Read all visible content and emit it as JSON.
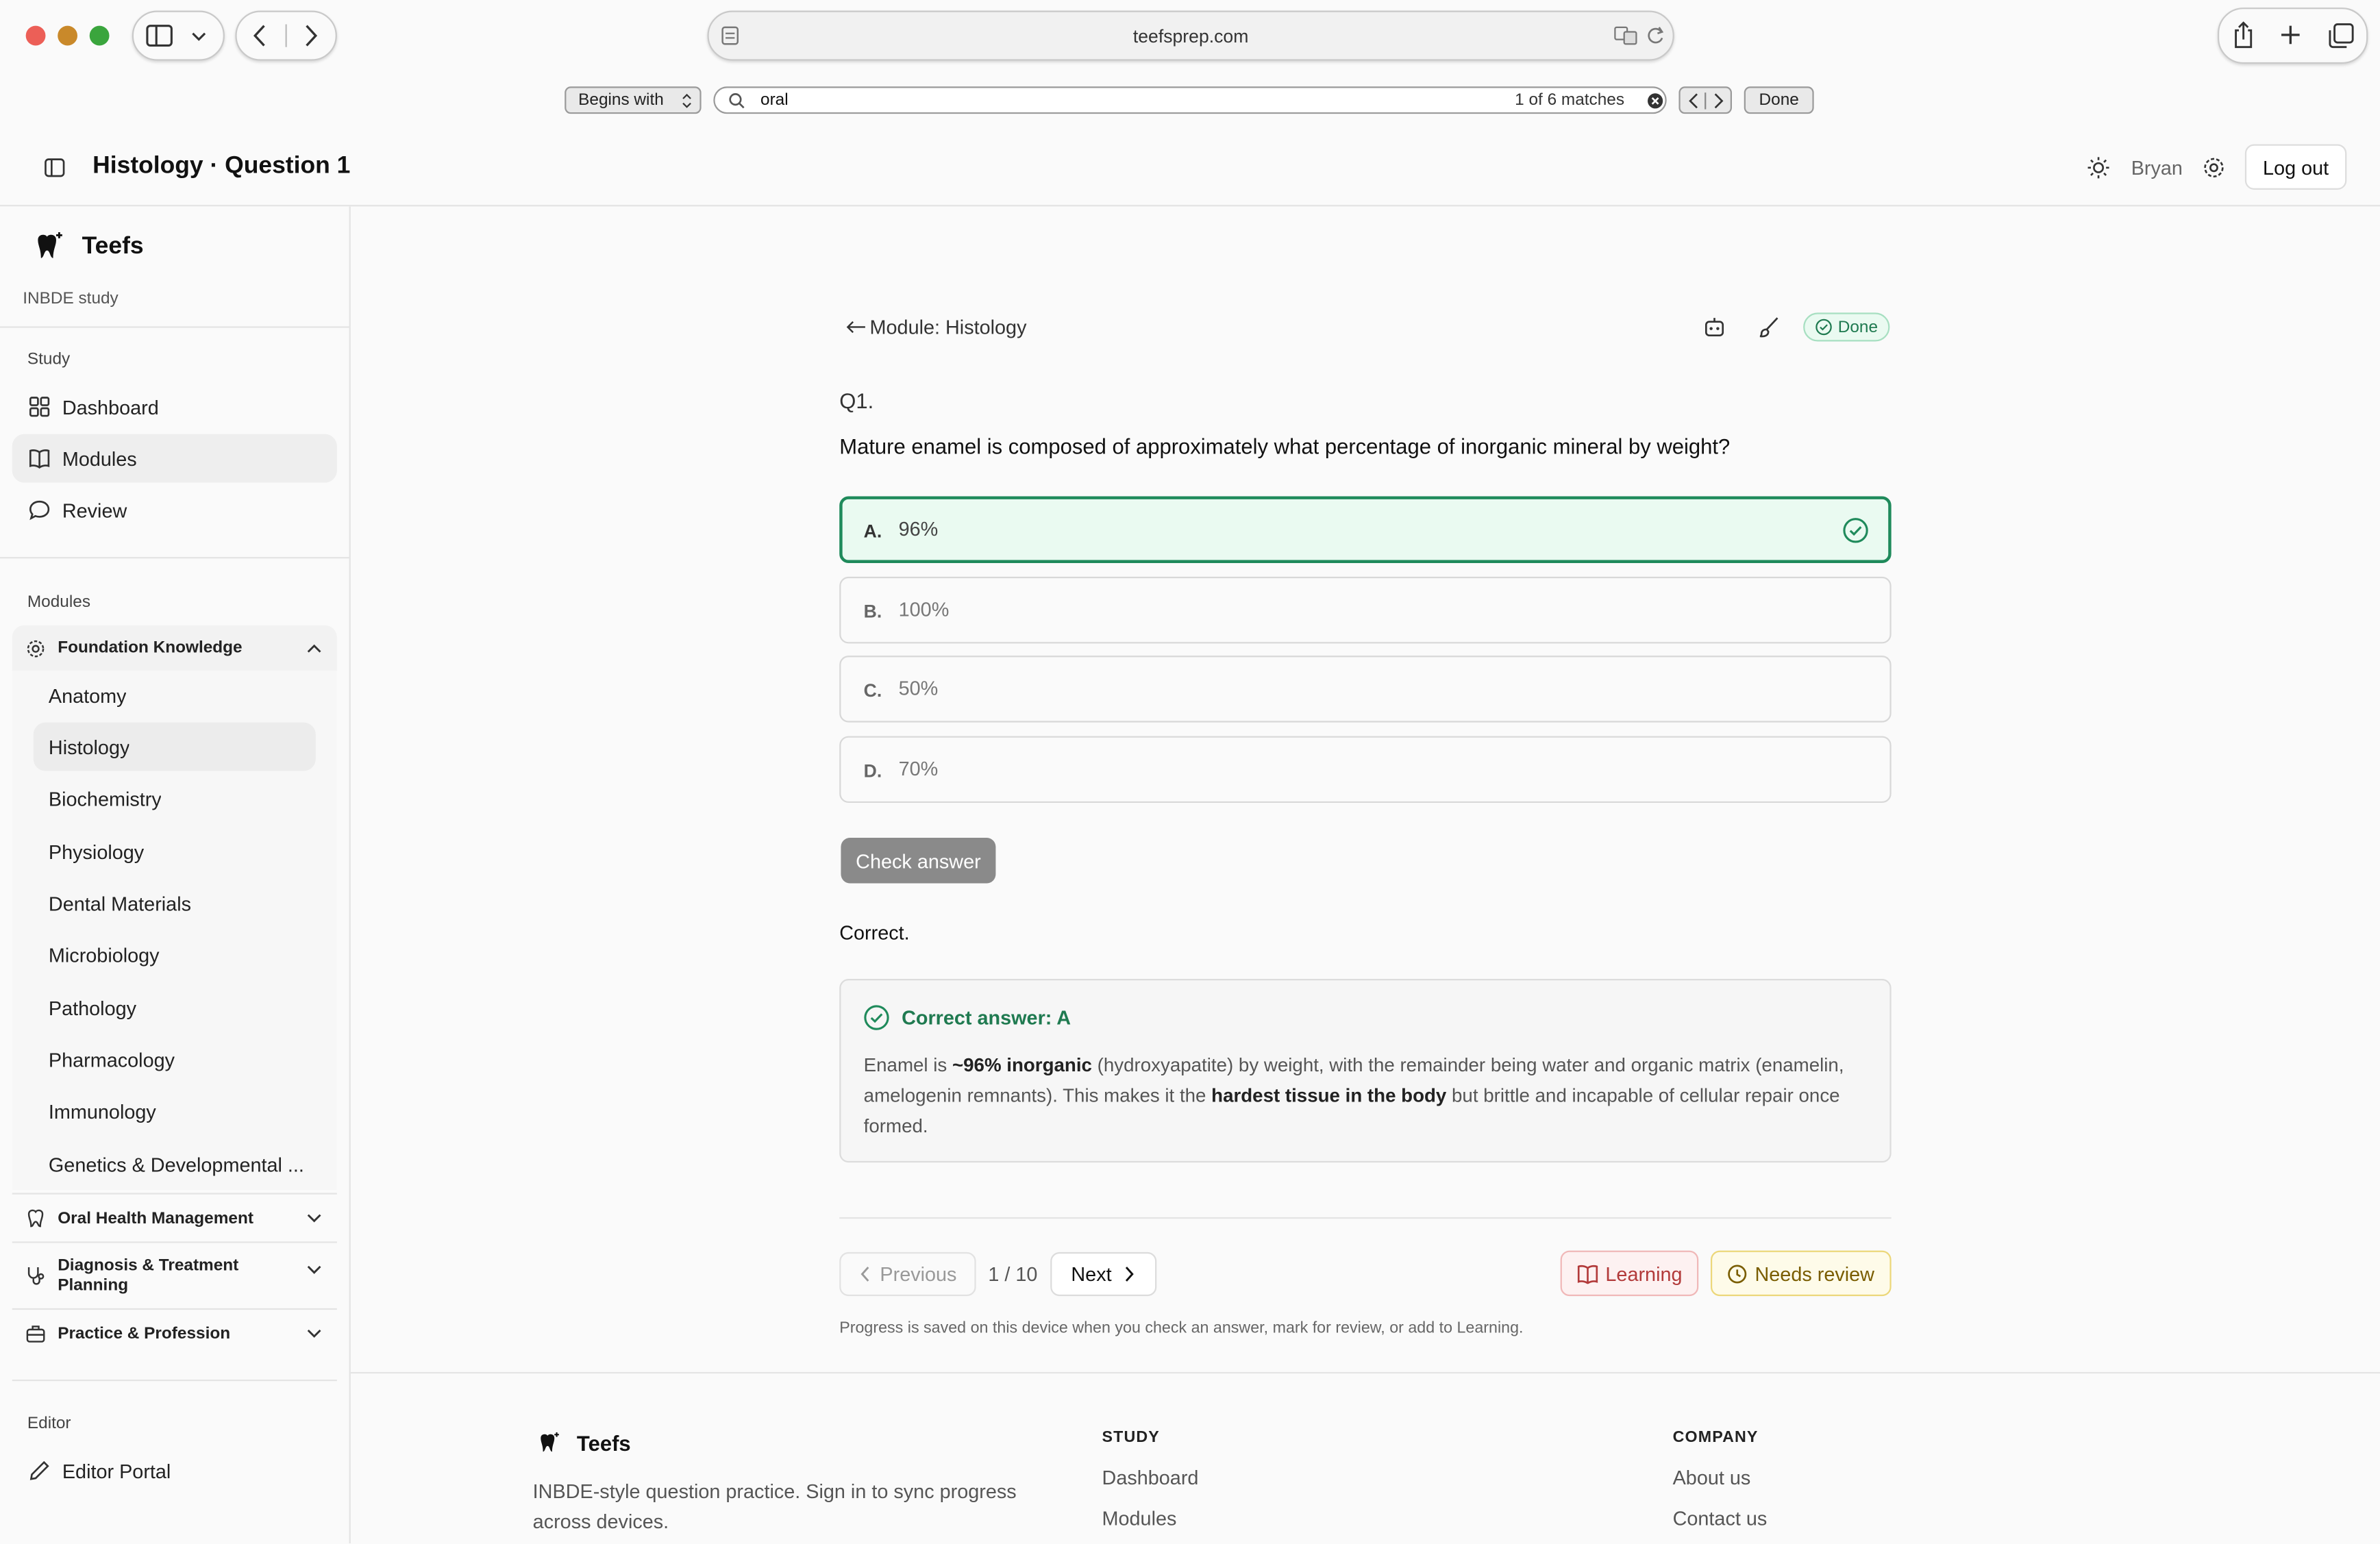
{
  "browser": {
    "url": "teefsprep.com",
    "find_bar": {
      "mode": "Begins with",
      "query": "oral",
      "match_count": "1 of 6 matches",
      "done_label": "Done"
    }
  },
  "header": {
    "title": "Histology · Question 1",
    "username": "Bryan",
    "logout_label": "Log out"
  },
  "sidebar": {
    "app_name": "Teefs",
    "app_subtitle": "INBDE study",
    "study_section": "Study",
    "study_items": [
      "Dashboard",
      "Modules",
      "Review"
    ],
    "modules_section": "Modules",
    "groups": [
      {
        "label": "Foundation Knowledge",
        "expanded": true
      },
      {
        "label": "Oral Health Management",
        "expanded": false
      },
      {
        "label": "Diagnosis & Treatment Planning",
        "expanded": false
      },
      {
        "label": "Practice & Profession",
        "expanded": false
      }
    ],
    "foundation_items": [
      "Anatomy",
      "Histology",
      "Biochemistry",
      "Physiology",
      "Dental Materials",
      "Microbiology",
      "Pathology",
      "Pharmacology",
      "Immunology",
      "Genetics & Developmental ..."
    ],
    "active_item": "Histology",
    "editor_section": "Editor",
    "editor_item": "Editor Portal"
  },
  "question": {
    "back_link": "Module: Histology",
    "status_badge": "Done",
    "number": "Q1.",
    "text": "Mature enamel is composed of approximately what percentage of inorganic mineral by weight?",
    "options": [
      {
        "letter": "A.",
        "text": "96%",
        "state": "correct-selected"
      },
      {
        "letter": "B.",
        "text": "100%"
      },
      {
        "letter": "C.",
        "text": "50%"
      },
      {
        "letter": "D.",
        "text": "70%"
      }
    ],
    "check_button": "Check answer",
    "result": "Correct.",
    "explanation": {
      "heading": "Correct answer: A",
      "p1": "Enamel is ",
      "b1": "~96% inorganic",
      "p2": " (hydroxyapatite) by weight, with the remainder being water and organic matrix (enamelin, amelogenin remnants). This makes it the ",
      "b2": "hardest tissue in the body",
      "p3": " but brittle and incapable of cellular repair once formed."
    },
    "pagination": {
      "previous": "Previous",
      "position": "1 / 10",
      "next": "Next"
    },
    "learning_label": "Learning",
    "review_label": "Needs review",
    "progress_note": "Progress is saved on this device when you check an answer, mark for review, or add to Learning."
  },
  "footer": {
    "brand": "Teefs",
    "tagline": "INBDE-style question practice. Sign in to sync progress across devices.",
    "study_heading": "STUDY",
    "study_links": [
      "Dashboard",
      "Modules"
    ],
    "company_heading": "COMPANY",
    "company_links": [
      "About us",
      "Contact us"
    ]
  },
  "colors": {
    "accent_green": "#1f8a5b",
    "correct_bg": "#eafaf1",
    "learning_red": "#c0392b",
    "review_yellow": "#8a6d00"
  }
}
